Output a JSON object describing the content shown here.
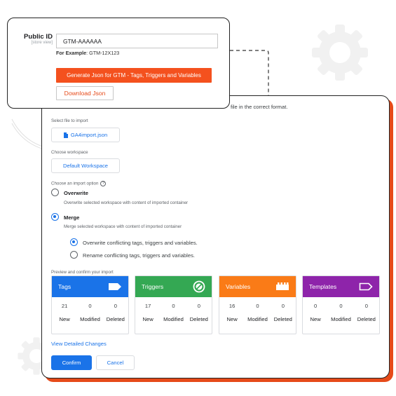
{
  "popup": {
    "public_id_label": "Public ID",
    "public_id_sublabel": "[store view]",
    "public_id_value": "GTM-AAAAAA",
    "example_prefix": "For Example",
    "example_value": ": GTM-12X123",
    "generate_button": "Generate Json for GTM - Tags, Triggers and Variables",
    "download_button": "Download Json"
  },
  "import_panel": {
    "hint_text": "file in the correct format.",
    "select_file_label": "Select file to import",
    "file_button": "GA4import.json",
    "workspace_label": "Choose workspace",
    "workspace_button": "Default Workspace",
    "import_option_label": "Choose an import option",
    "help_glyph": "?",
    "options": [
      {
        "title": "Overwrite",
        "desc": "Overwrite selected workspace with content of imported container",
        "selected": false
      },
      {
        "title": "Merge",
        "desc": "Merge selected workspace with content of imported container",
        "selected": true
      }
    ],
    "merge_suboptions": [
      {
        "label": "Overwrite conflicting tags, triggers and variables.",
        "selected": true
      },
      {
        "label": "Rename conflicting tags, triggers and variables.",
        "selected": false
      }
    ],
    "preview_label": "Preview and confirm your import",
    "column_labels": [
      "New",
      "Modified",
      "Deleted"
    ],
    "cards": [
      {
        "title": "Tags",
        "icon": "tag-icon",
        "color": "#1a73e8",
        "counts": [
          "21",
          "0",
          "0"
        ]
      },
      {
        "title": "Triggers",
        "icon": "trigger-icon",
        "color": "#34a853",
        "counts": [
          "17",
          "0",
          "0"
        ]
      },
      {
        "title": "Variables",
        "icon": "variables-icon",
        "color": "#fa7b17",
        "counts": [
          "16",
          "0",
          "0"
        ]
      },
      {
        "title": "Templates",
        "icon": "template-icon",
        "color": "#8e24aa",
        "counts": [
          "0",
          "0",
          "0"
        ]
      }
    ],
    "view_changes_link": "View Detailed Changes",
    "confirm_button": "Confirm",
    "cancel_button": "Cancel"
  },
  "colors": {
    "accent_blue": "#1a73e8",
    "accent_orange": "#f4511e",
    "panel_shadow": "#e64a19"
  }
}
